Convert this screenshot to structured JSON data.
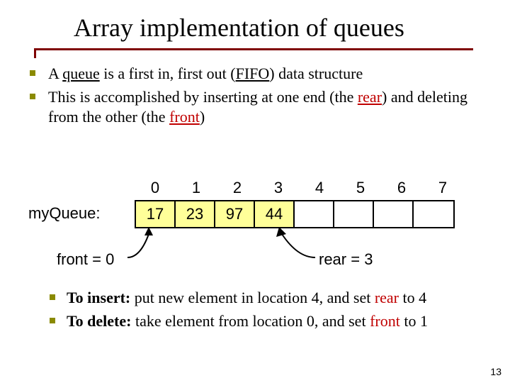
{
  "title": "Array implementation of queues",
  "bullets": {
    "b1_pre": "A ",
    "b1_u1": "queue",
    "b1_mid": " is a first in, first out (",
    "b1_u2": "FIFO",
    "b1_post": ") data structure",
    "b2_pre": "This is accomplished by inserting at one end (the ",
    "b2_rear": "rear",
    "b2_mid": ") and deleting from the other (the ",
    "b2_front": "front",
    "b2_post": ")"
  },
  "array_label": "myQueue:",
  "indices": [
    "0",
    "1",
    "2",
    "3",
    "4",
    "5",
    "6",
    "7"
  ],
  "cells": [
    "17",
    "23",
    "97",
    "44",
    "",
    "",
    "",
    ""
  ],
  "front_label": "front = 0",
  "rear_label": "rear = 3",
  "bottom": {
    "ins_b": "To insert:",
    "ins_pre": " put new element in  location 4, and set ",
    "ins_rear": "rear",
    "ins_post": " to 4",
    "del_b": "To delete:",
    "del_pre": " take element from location 0, and set ",
    "del_front": "front",
    "del_post": " to 1"
  },
  "pagenum": "13"
}
